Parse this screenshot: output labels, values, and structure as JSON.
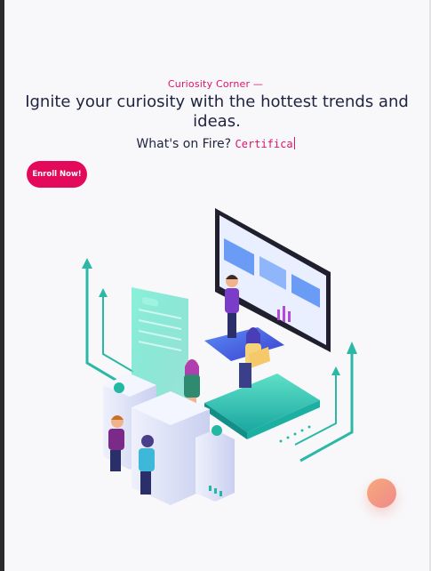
{
  "hero": {
    "tagline": "Curiosity Corner —",
    "headline": "Ignite your curiosity with the hottest trends and ideas.",
    "subline_prefix": "What's on Fire?",
    "typed_text": "Certifica",
    "enroll_label": "Enroll Now!"
  },
  "colors": {
    "accent": "#e30a5c",
    "heading": "#1f2340",
    "teal": "#2bc4b0",
    "indigo": "#3b4bd8"
  }
}
